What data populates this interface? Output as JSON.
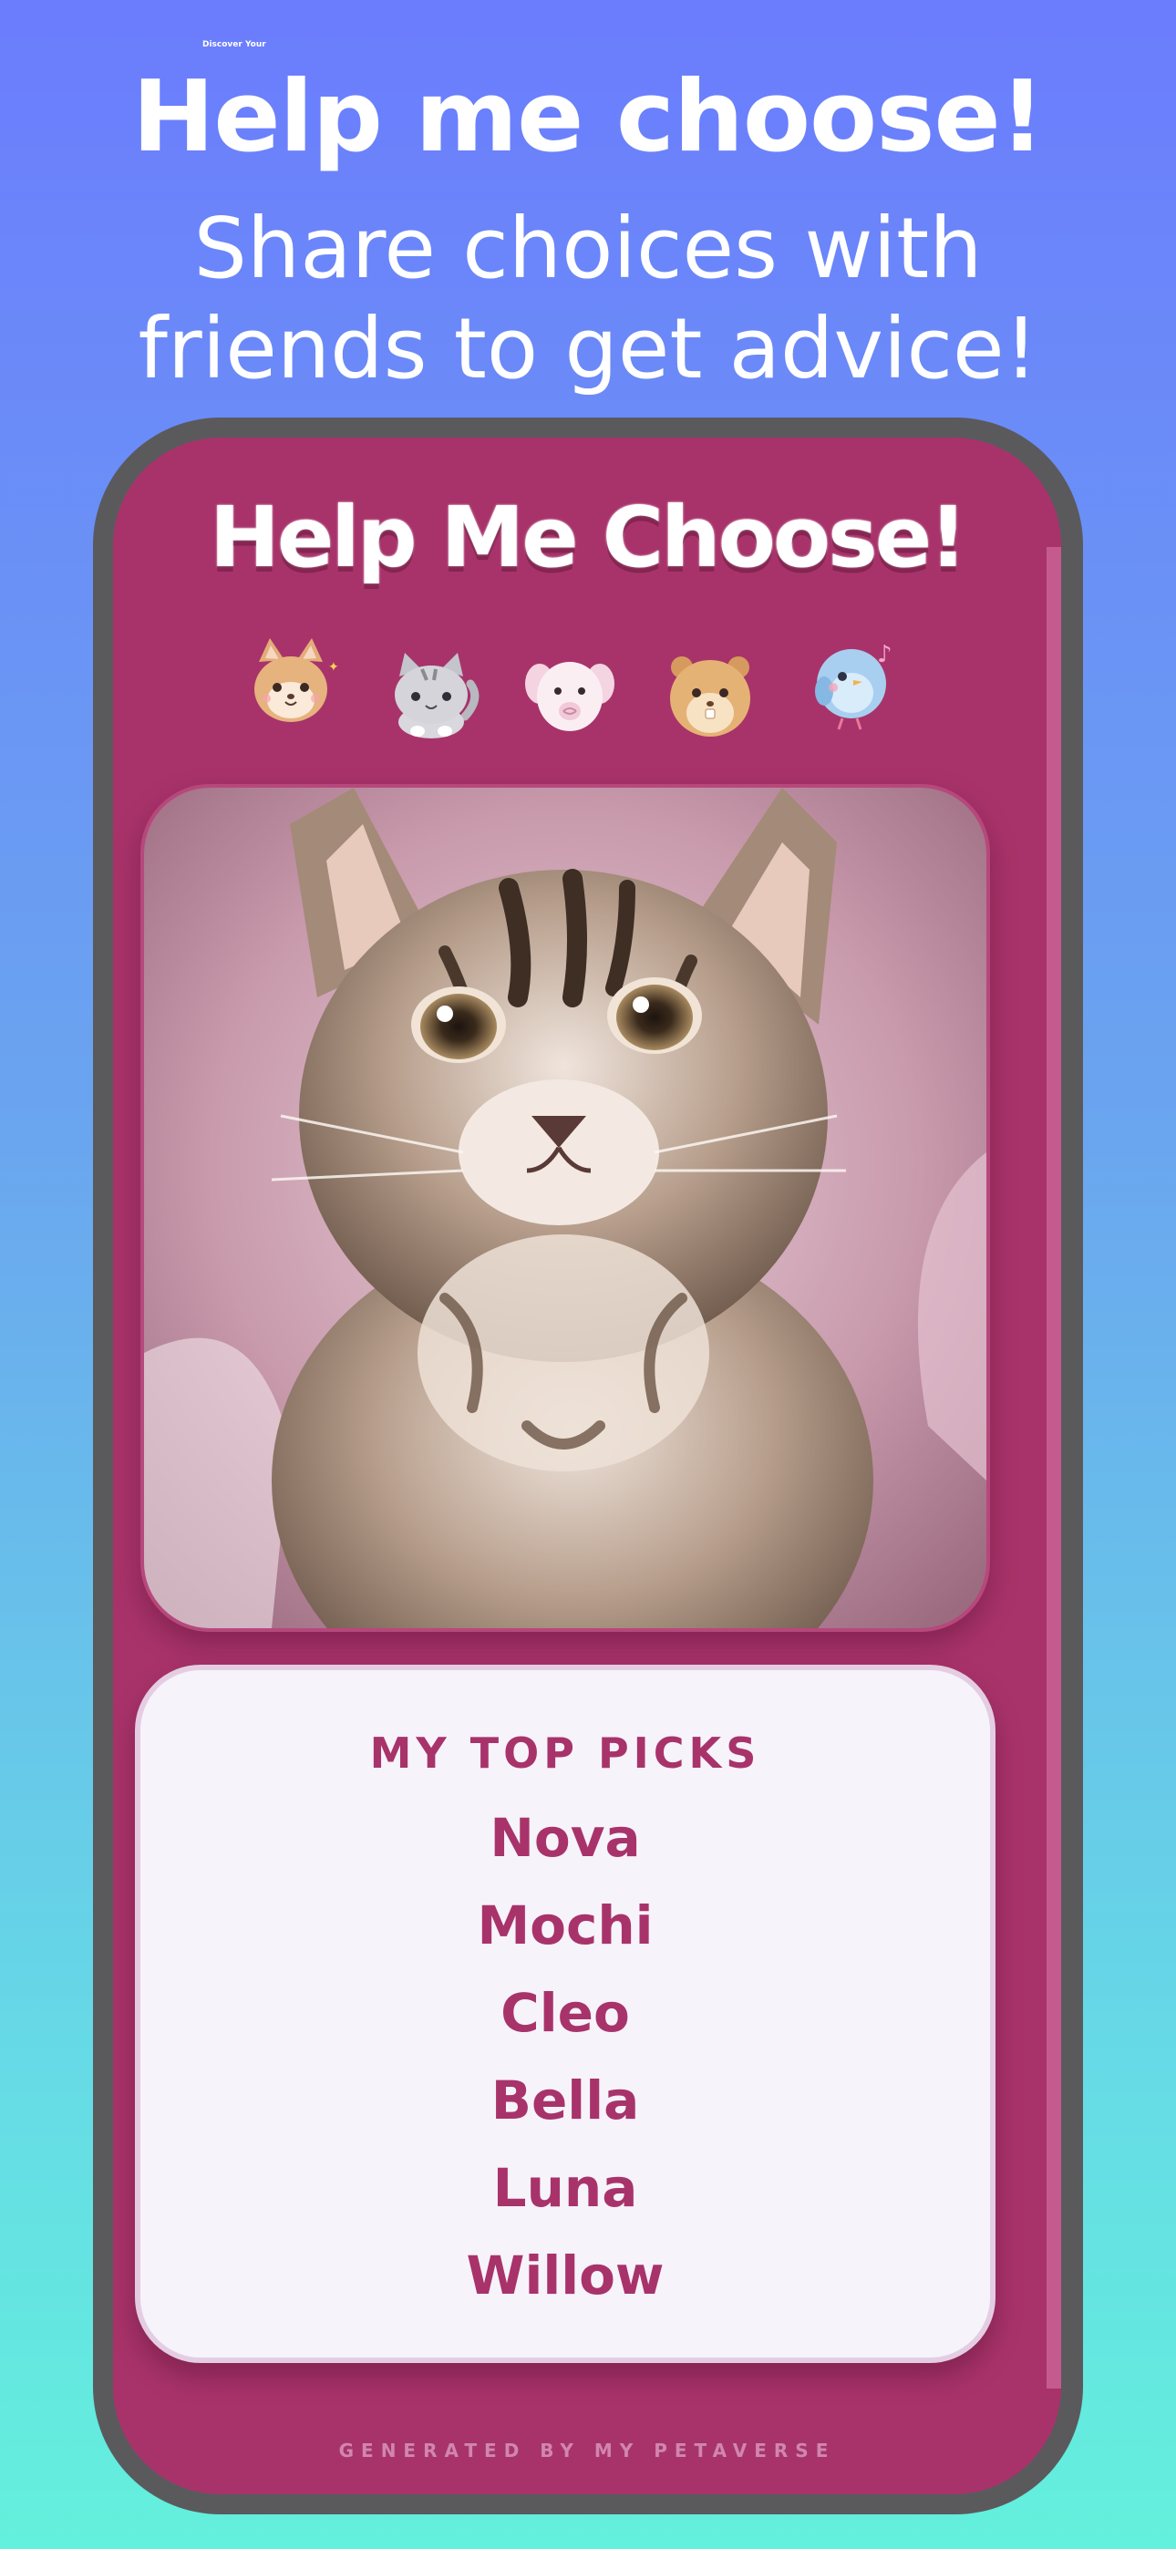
{
  "banner": {
    "small_label": "Discover Your",
    "headline": "Help me choose!",
    "subheadline": "Share choices with friends to get advice!"
  },
  "app": {
    "title": "Help Me Choose!",
    "pet_icons": [
      "fox-icon",
      "cat-icon",
      "puppy-icon",
      "hamster-icon",
      "bird-icon"
    ],
    "photo": {
      "subject": "kitten-photo"
    },
    "picks": {
      "heading": "MY TOP PICKS",
      "names": [
        "Nova",
        "Mochi",
        "Cleo",
        "Bella",
        "Luna",
        "Willow"
      ]
    },
    "footer": "GENERATED BY MY PETAVERSE"
  },
  "colors": {
    "background_top": "#6b7cfd",
    "background_bottom": "#63f0dc",
    "app_accent": "#a8336a",
    "card_background": "#f6f3fb",
    "phone_frame": "#5a5a5d"
  }
}
